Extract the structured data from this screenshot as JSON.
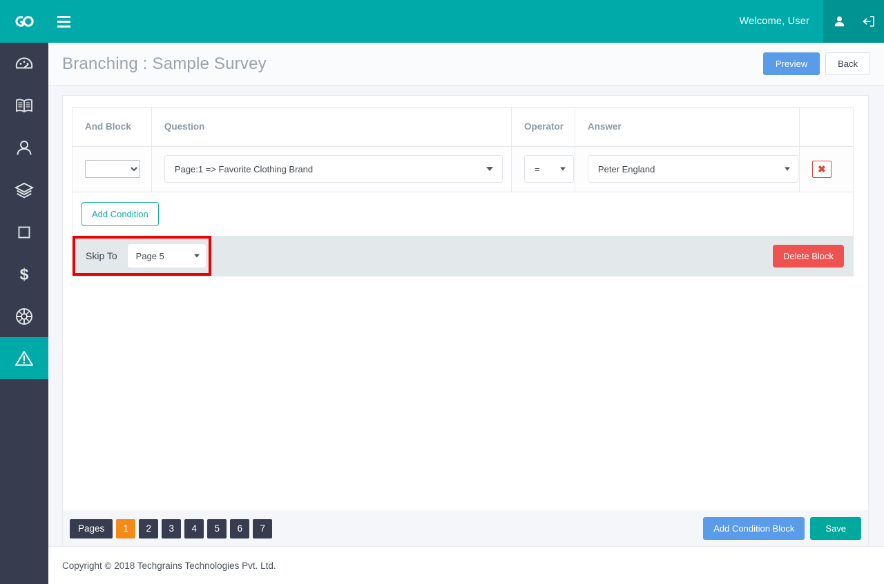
{
  "topbar": {
    "logo_icon": "go-logo-icon",
    "menu_icon": "hamburger-menu-icon",
    "welcome": "Welcome, User",
    "user_icon": "user-account-icon",
    "logout_icon": "logout-icon",
    "background_color": "#00aaa9"
  },
  "sidebar": {
    "background_color": "#373d4f",
    "active_color": "#00aaa9",
    "items": [
      {
        "icon": "dashboard-speedometer-icon",
        "active": false
      },
      {
        "icon": "book-icon",
        "active": false
      },
      {
        "icon": "user-icon",
        "active": false
      },
      {
        "icon": "layers-icon",
        "active": false
      },
      {
        "icon": "square-icon",
        "active": false
      },
      {
        "icon": "dollar-icon",
        "active": false
      },
      {
        "icon": "globe-icon",
        "active": false
      },
      {
        "icon": "warning-triangle-icon",
        "active": true
      }
    ]
  },
  "page_header": {
    "title": "Branching : Sample Survey",
    "preview_label": "Preview",
    "back_label": "Back",
    "preview_color": "#5a9bea"
  },
  "condition_block": {
    "columns": {
      "and_block": "And Block",
      "question": "Question",
      "operator": "Operator",
      "answer": "Answer",
      "actions": ""
    },
    "rows": [
      {
        "and_block_value": "",
        "question_value": "Page:1 => Favorite Clothing Brand",
        "operator_value": "=",
        "answer_value": "Peter England",
        "remove_icon": "remove-condition-icon",
        "remove_glyph": "✖"
      }
    ],
    "add_condition_label": "Add Condition",
    "skip_to_label": "Skip To",
    "skip_to_value": "Page 5",
    "delete_block_label": "Delete Block",
    "delete_block_color": "#ef5350",
    "highlight_color": "#ef0000"
  },
  "bottom_bar": {
    "pages_label": "Pages",
    "pages": [
      "1",
      "2",
      "3",
      "4",
      "5",
      "6",
      "7"
    ],
    "active_page": "1",
    "active_page_color": "#f28b17",
    "add_condition_block_label": "Add Condition Block",
    "save_label": "Save",
    "save_color": "#00a99d"
  },
  "footer": {
    "copyright": "Copyright © 2018 Techgrains Technologies Pvt. Ltd."
  }
}
